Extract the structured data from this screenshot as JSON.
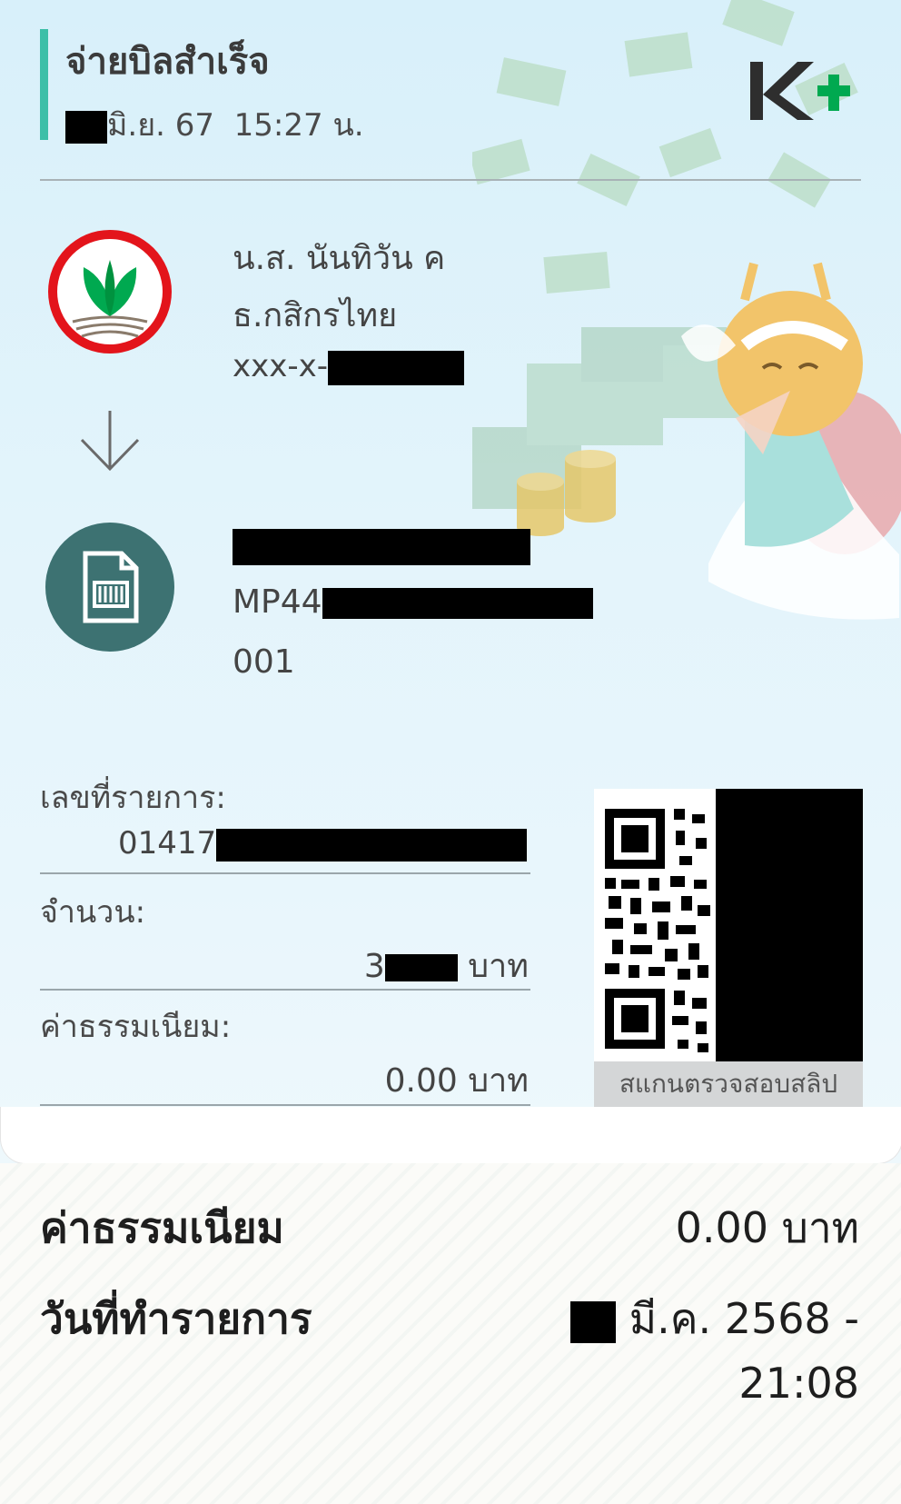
{
  "header": {
    "title": "จ่ายบิลสำเร็จ",
    "date": "มิ.ย. 67",
    "time": "15:27 น."
  },
  "brand": {
    "logo_text": "K+",
    "accent": "#3dbfa8",
    "green": "#00a950"
  },
  "sender": {
    "name": "น.ส. นันทิวัน ค",
    "bank": "ธ.กสิกรไทย",
    "account_prefix": "xxx-x-"
  },
  "biller": {
    "ref1_prefix": "MP44",
    "ref2": "001"
  },
  "details": {
    "txid_label": "เลขที่รายการ:",
    "txid_prefix": "01417",
    "amount_label": "จำนวน:",
    "amount_prefix": "3",
    "amount_unit": "บาท",
    "fee_label": "ค่าธรรมเนียม:",
    "fee_value": "0.00 บาท"
  },
  "qr": {
    "caption": "สแกนตรวจสอบสลิป"
  },
  "summary": {
    "fee_label": "ค่าธรรมเนียม",
    "fee_value": "0.00 บาท",
    "date_label": "วันที่ทำรายการ",
    "date_value": "มี.ค. 2568 -",
    "time_value": "21:08"
  },
  "icons": [
    "kasikorn-bank-logo-icon",
    "arrow-down-icon",
    "bill-document-icon",
    "qr-code-icon"
  ]
}
